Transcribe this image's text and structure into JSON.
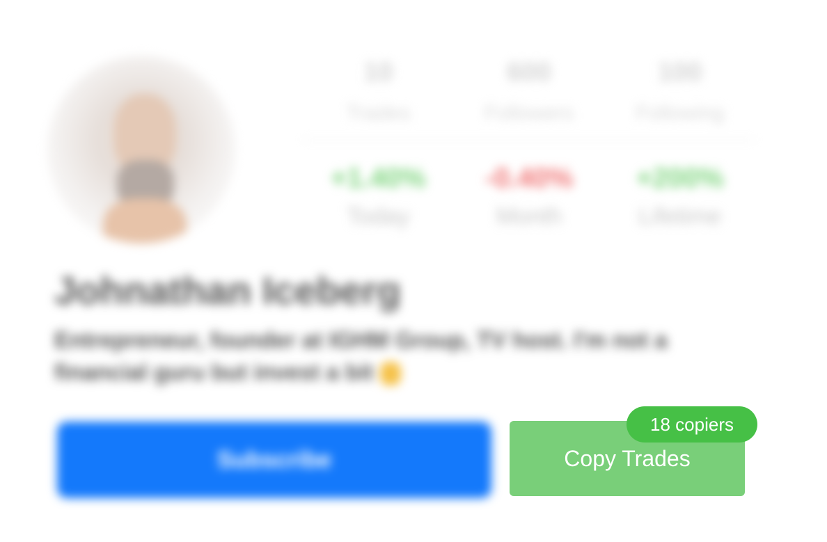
{
  "profile": {
    "name": "Johnathan Iceberg",
    "bio": "Entrepreneur, founder at IGHM Group, TV host. I'm not a financial guru but invest a bit"
  },
  "stats": [
    {
      "value": "10",
      "label": "Trades"
    },
    {
      "value": "600",
      "label": "Followers"
    },
    {
      "value": "100",
      "label": "Following"
    }
  ],
  "performance": [
    {
      "value": "+1.40%",
      "label": "Today",
      "color": "#7fd57f"
    },
    {
      "value": "-0.40%",
      "label": "Month",
      "color": "#f07878"
    },
    {
      "value": "+200%",
      "label": "Lifetime",
      "color": "#7fd57f"
    }
  ],
  "actions": {
    "subscribe_label": "Subscribe",
    "copy_trades_label": "Copy Trades",
    "copiers_badge": "18 copiers"
  },
  "colors": {
    "subscribe": "#1479fb",
    "copy_trades": "#79cf79",
    "badge": "#46c046"
  },
  "icons": {
    "bio_emoji": "hand-emoji-icon"
  }
}
